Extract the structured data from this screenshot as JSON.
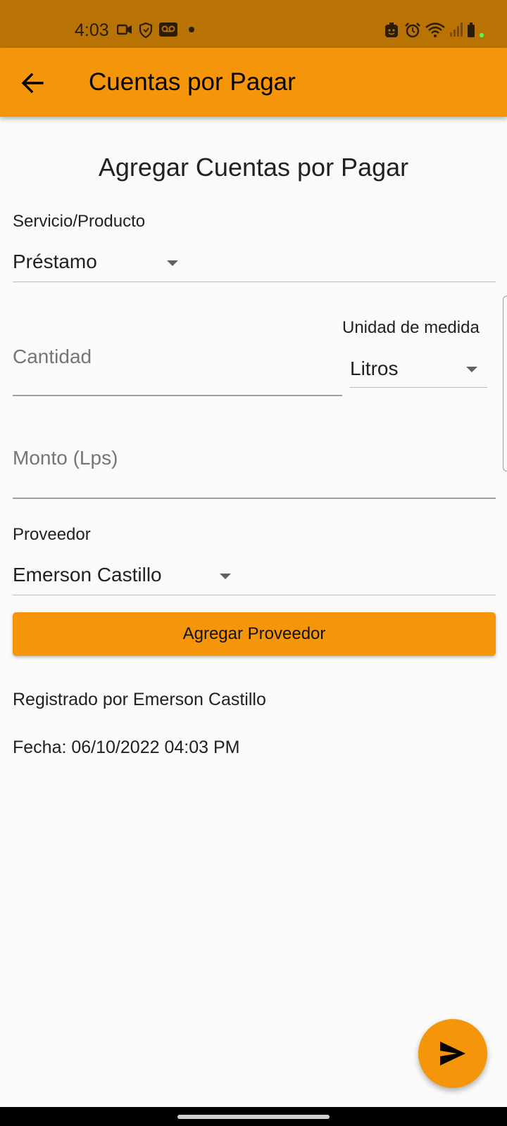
{
  "status_bar": {
    "time": "4:03",
    "icons_left": [
      "video-camera-icon",
      "shield-icon",
      "voicemail-icon",
      "dot-icon"
    ],
    "icons_right": [
      "face-icon",
      "alarm-icon",
      "wifi-icon",
      "signal-icon",
      "battery-icon"
    ]
  },
  "app_bar": {
    "title": "Cuentas por Pagar",
    "back_icon": "arrow-left-icon"
  },
  "form": {
    "heading": "Agregar Cuentas por Pagar",
    "service_label": "Servicio/Producto",
    "service_value": "Préstamo",
    "quantity_placeholder": "Cantidad",
    "unit_label": "Unidad de medida",
    "unit_value": "Litros",
    "amount_placeholder": "Monto (Lps)",
    "supplier_label": "Proveedor",
    "supplier_value": "Emerson Castillo",
    "add_supplier_label": "Agregar Proveedor",
    "registered_by": "Registrado por Emerson Castillo",
    "date": "Fecha: 06/10/2022 04:03 PM"
  },
  "fab": {
    "icon": "send-icon"
  },
  "colors": {
    "status_bar": "#b97204",
    "accent": "#f5960a",
    "background": "#fafafa"
  }
}
